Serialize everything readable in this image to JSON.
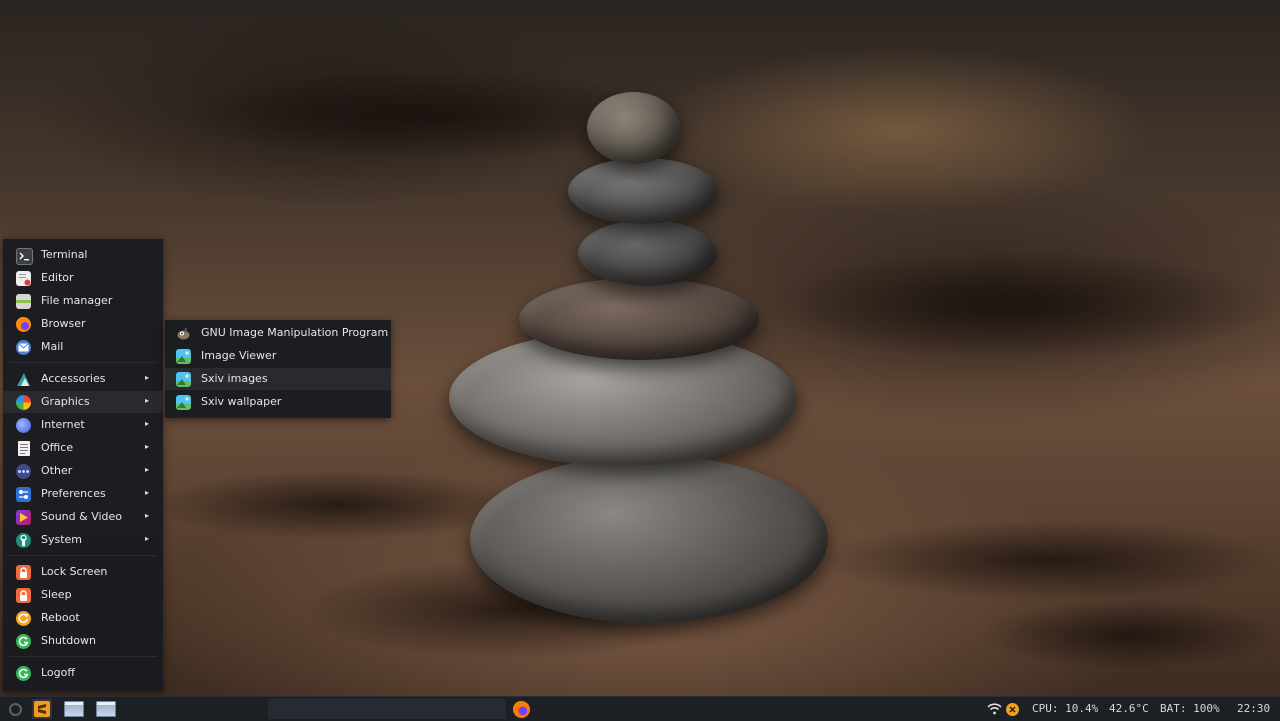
{
  "main_menu": {
    "items": [
      {
        "label": "Terminal",
        "icon": "terminal-icon"
      },
      {
        "label": "Editor",
        "icon": "editor-icon"
      },
      {
        "label": "File manager",
        "icon": "file-manager-icon"
      },
      {
        "label": "Browser",
        "icon": "firefox-icon"
      },
      {
        "label": "Mail",
        "icon": "mail-icon"
      },
      {
        "label": "Accessories",
        "icon": "accessories-icon",
        "submenu": true
      },
      {
        "label": "Graphics",
        "icon": "graphics-icon",
        "submenu": true,
        "active": true
      },
      {
        "label": "Internet",
        "icon": "internet-icon",
        "submenu": true
      },
      {
        "label": "Office",
        "icon": "office-icon",
        "submenu": true
      },
      {
        "label": "Other",
        "icon": "other-icon",
        "submenu": true
      },
      {
        "label": "Preferences",
        "icon": "preferences-icon",
        "submenu": true
      },
      {
        "label": "Sound & Video",
        "icon": "sound-video-icon",
        "submenu": true
      },
      {
        "label": "System",
        "icon": "system-icon",
        "submenu": true
      },
      {
        "label": "Lock Screen",
        "icon": "lock-icon"
      },
      {
        "label": "Sleep",
        "icon": "sleep-icon"
      },
      {
        "label": "Reboot",
        "icon": "reboot-icon"
      },
      {
        "label": "Shutdown",
        "icon": "shutdown-icon"
      },
      {
        "label": "Logoff",
        "icon": "logoff-icon"
      }
    ],
    "arrow": "▸"
  },
  "graphics_submenu": {
    "items": [
      {
        "label": "GNU Image Manipulation Program",
        "icon": "gimp-icon"
      },
      {
        "label": "Image Viewer",
        "icon": "image-viewer-icon"
      },
      {
        "label": "Sxiv images",
        "icon": "sxiv-images-icon",
        "active": true
      },
      {
        "label": "Sxiv wallpaper",
        "icon": "sxiv-wallpaper-icon"
      }
    ]
  },
  "taskbar": {
    "cpu": "CPU: 10.4%",
    "temp": "42.6°C",
    "battery": "BAT: 100%",
    "clock": "22:30"
  },
  "colors": {
    "menu_bg": "#181b20",
    "taskbar_bg": "#1c1f24",
    "accent_orange": "#f0a020"
  }
}
